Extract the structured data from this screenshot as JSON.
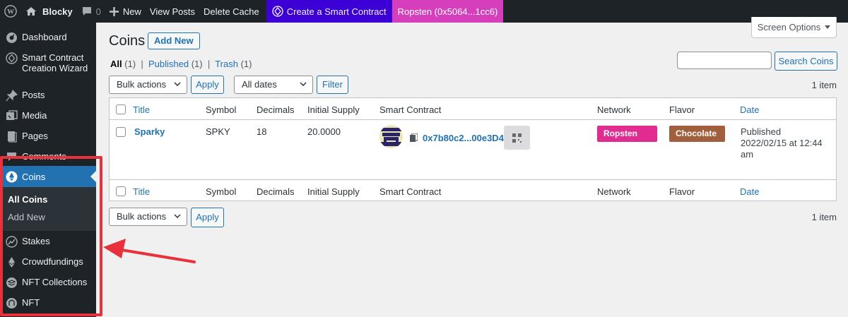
{
  "adminbar": {
    "site_name": "Blocky",
    "comments_count": "0",
    "new_label": "New",
    "view_posts": "View Posts",
    "delete_cache": "Delete Cache",
    "create_contract": "Create a Smart Contract",
    "network": "Ropsten (0x5064...1cc6)",
    "create_contract_color": "#3c00d6",
    "network_color": "#d63fbc"
  },
  "sidebar": {
    "dashboard": "Dashboard",
    "wizard": "Smart Contract Creation Wizard",
    "posts": "Posts",
    "media": "Media",
    "pages": "Pages",
    "comments": "Comments",
    "coins": "Coins",
    "sub_all_coins": "All Coins",
    "sub_add_new": "Add New",
    "stakes": "Stakes",
    "crowdfundings": "Crowdfundings",
    "nft_collections": "NFT Collections",
    "nft": "NFT",
    "active_color": "#2271b1"
  },
  "page": {
    "title": "Coins",
    "add_new": "Add New",
    "screen_options": "Screen Options",
    "filter_all": "All",
    "filter_all_count": "(1)",
    "filter_published": "Published",
    "filter_published_count": "(1)",
    "filter_trash": "Trash",
    "filter_trash_count": "(1)",
    "search_value": "",
    "search_button": "Search Coins",
    "bulk_actions": "Bulk actions",
    "apply": "Apply",
    "all_dates": "All dates",
    "filter_button": "Filter",
    "items_count": "1 item"
  },
  "table": {
    "headers": {
      "title": "Title",
      "symbol": "Symbol",
      "decimals": "Decimals",
      "initial_supply": "Initial Supply",
      "smart_contract": "Smart Contract",
      "network": "Network",
      "flavor": "Flavor",
      "date": "Date"
    },
    "row": {
      "title": "Sparky",
      "symbol": "SPKY",
      "decimals": "18",
      "initial_supply": "20.0000",
      "contract_address": "0x7b80c2...00e3D4",
      "network": "Ropsten",
      "network_color": "#e02c90",
      "flavor": "Chocolate",
      "flavor_color": "#a0603d",
      "date_status": "Published",
      "date_value": "2022/02/15 at 12:44 am"
    }
  },
  "annotation": {
    "highlight_color": "#e8313b"
  }
}
